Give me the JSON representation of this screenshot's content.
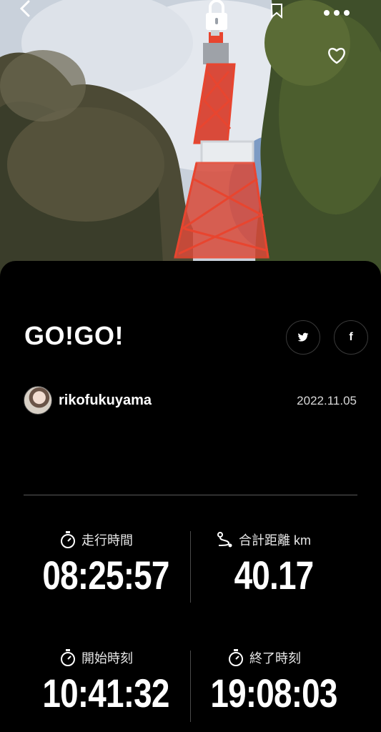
{
  "post": {
    "title": "GO!GO!",
    "username": "rikofukuyama",
    "date": "2022.11.05"
  },
  "share": {
    "twitter_glyph": "🐦",
    "facebook_glyph": "f"
  },
  "stats": {
    "run_time_label": "走行時間",
    "run_time_value": "08:25:57",
    "distance_label": "合計距離 km",
    "distance_value": "40.17",
    "start_label": "開始時刻",
    "start_value": "10:41:32",
    "end_label": "終了時刻",
    "end_value": "19:08:03"
  },
  "icons": {
    "back": "chevron-left-icon",
    "lock": "lock-icon",
    "bookmark": "bookmark-icon",
    "more": "more-icon",
    "like": "heart-icon",
    "stopwatch": "stopwatch-icon",
    "route": "route-icon",
    "twitter": "twitter-icon",
    "facebook": "facebook-icon"
  },
  "colors": {
    "background": "#000000",
    "tower": "#e8452f",
    "text": "#ffffff"
  }
}
